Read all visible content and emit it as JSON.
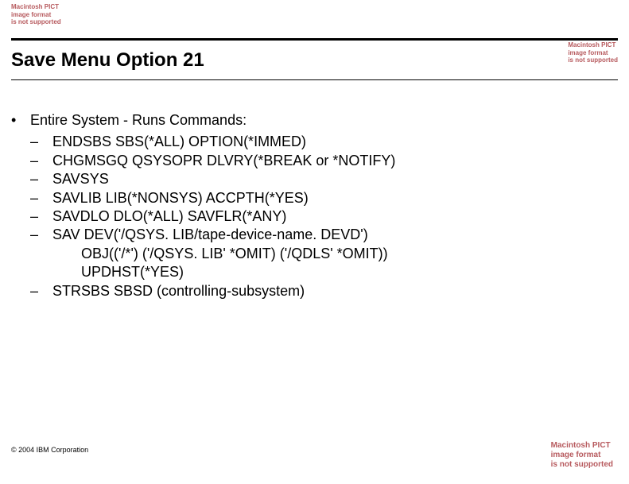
{
  "pict_error": {
    "l1": "Macintosh PICT",
    "l2": "image format",
    "l3": "is not supported"
  },
  "title": "Save Menu Option 21",
  "main_bullet": "Entire System - Runs Commands:",
  "subs": [
    "ENDSBS SBS(*ALL) OPTION(*IMMED)",
    "CHGMSGQ QSYSOPR DLVRY(*BREAK or *NOTIFY)",
    "SAVSYS",
    "SAVLIB LIB(*NONSYS) ACCPTH(*YES)",
    "SAVDLO DLO(*ALL)  SAVFLR(*ANY)",
    "SAV DEV('/QSYS. LIB/tape-device-name. DEVD')"
  ],
  "sav_cont": [
    "OBJ(('/*') ('/QSYS. LIB' *OMIT)  ('/QDLS' *OMIT))",
    "UPDHST(*YES)"
  ],
  "subs_after": [
    "STRSBS SBSD (controlling-subsystem)"
  ],
  "footer": "© 2004 IBM Corporation"
}
